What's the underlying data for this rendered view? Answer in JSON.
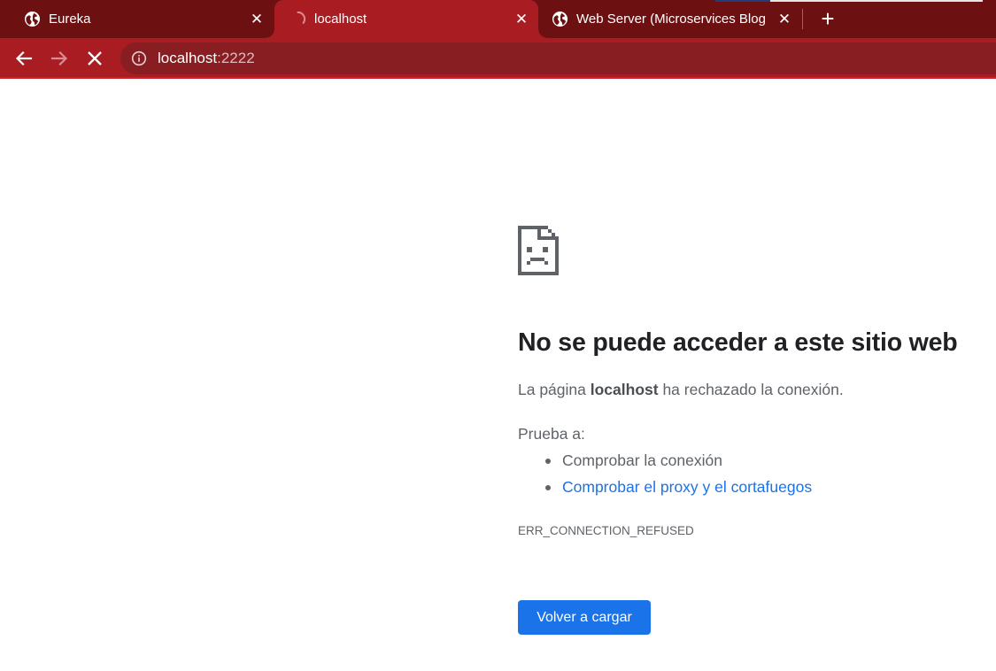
{
  "browser": {
    "tabs": [
      {
        "title": "Eureka",
        "favicon": "globe-icon",
        "close": "✕"
      },
      {
        "title": "localhost",
        "favicon": "loading-spinner-icon",
        "close": "✕"
      },
      {
        "title": "Web Server (Microservices Blog D",
        "favicon": "globe-icon",
        "close": "✕"
      }
    ],
    "new_tab": "+",
    "address_bar": {
      "host": "localhost",
      "port": ":2222",
      "icon": "info-icon"
    },
    "colors": {
      "tabstrip": "#6d1011",
      "active_tab": "#a81c22",
      "toolbar": "#a81c22",
      "omnibox": "#891e22"
    }
  },
  "error_page": {
    "icon": "sad-page-icon",
    "heading": "No se puede acceder a este sitio web",
    "description": {
      "prefix": "La página ",
      "host": "localhost",
      "suffix": " ha rechazado la conexión."
    },
    "try_label": "Prueba a:",
    "suggestions": [
      "Comprobar la conexión",
      "Comprobar el proxy y el cortafuegos"
    ],
    "error_code": "ERR_CONNECTION_REFUSED",
    "reload_button": "Volver a cargar",
    "colors": {
      "link": "#1a73e8",
      "button": "#1a73e8",
      "heading": "#202124",
      "text": "#5f6368"
    }
  }
}
